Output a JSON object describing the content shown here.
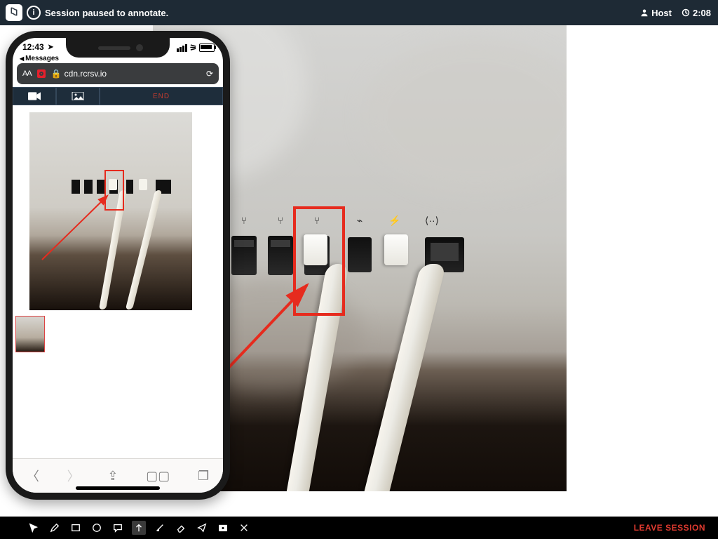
{
  "topbar": {
    "status": "Session paused to annotate.",
    "role": "Host",
    "timer": "2:08"
  },
  "phone": {
    "status_time": "12:43",
    "status_back": "Messages",
    "url_aa": "AA",
    "url": "cdn.rcrsv.io",
    "toolbar_end": "END"
  },
  "bottom": {
    "leave": "LEAVE SESSION"
  },
  "tools": {
    "pointer": "pointer",
    "pencil": "pencil",
    "rect": "rectangle",
    "circle": "circle",
    "chat": "chat",
    "arrow": "arrow",
    "pen": "pen",
    "eraser": "eraser",
    "send": "send",
    "camera": "camera",
    "close": "close"
  },
  "annotation": {
    "highlight": "usb-port-4"
  },
  "colors": {
    "accent": "#e62b1e"
  }
}
